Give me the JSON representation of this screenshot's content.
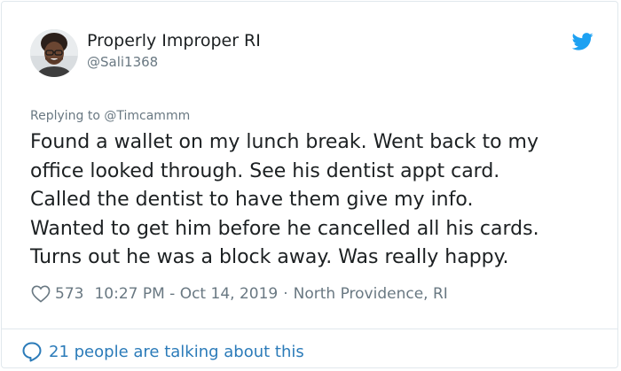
{
  "tweet": {
    "author": {
      "display_name": "Properly Improper RI",
      "handle": "@Sali1368",
      "avatar_icon": "user-avatar-photo"
    },
    "reply_to": "Replying to @Timcammm",
    "text_lines": [
      "Found a wallet on my lunch break. Went back to my",
      "office looked through. See his dentist appt card.",
      "Called the dentist to have them give my info.",
      "Wanted to get him before he cancelled all his cards.",
      "Turns out he was a block away. Was really happy."
    ],
    "meta": {
      "likes": "573",
      "timestamp": "10:27 PM - Oct 14, 2019",
      "separator": "·",
      "location": "North Providence, RI"
    },
    "conversation_text": "21 people are talking about this"
  },
  "icons": {
    "brand": "twitter-bird-icon",
    "like": "heart-icon",
    "conversation": "speech-bubble-icon"
  },
  "colors": {
    "twitter_blue": "#1da1f2",
    "link_blue": "#2b7bb9",
    "secondary_text": "#697882",
    "primary_text": "#1c2022",
    "border": "#e1e8ed"
  }
}
